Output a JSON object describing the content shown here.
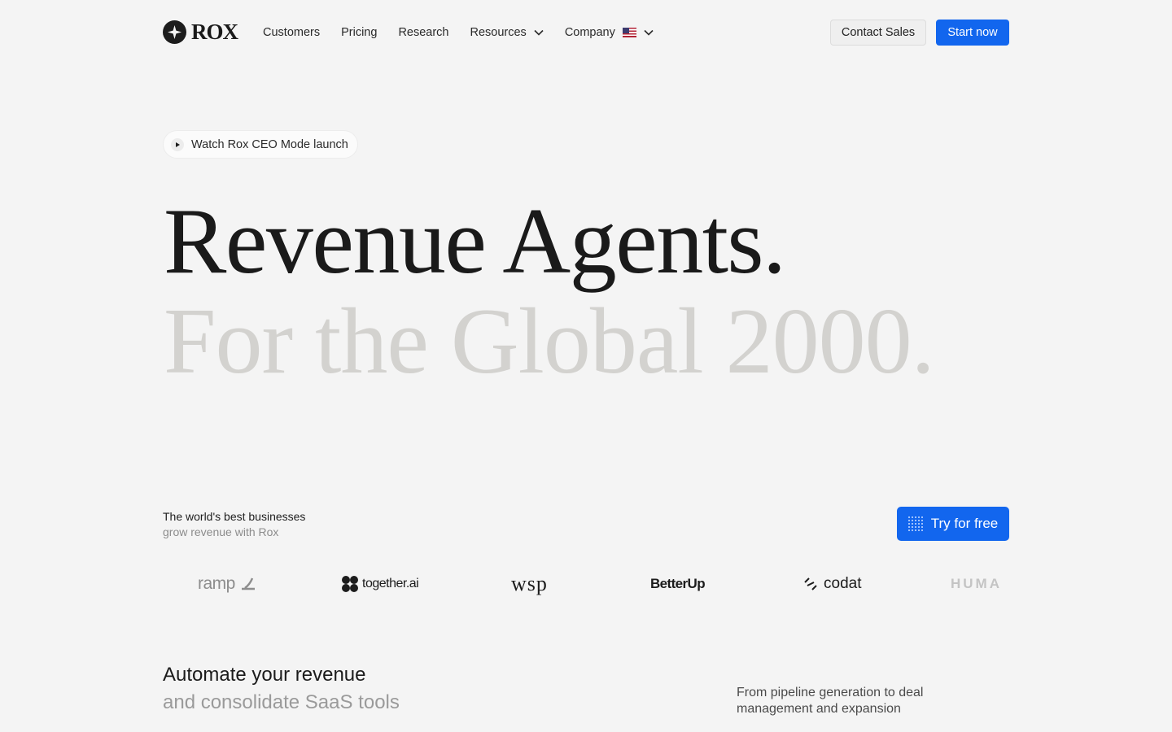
{
  "header": {
    "logo_text": "ROX",
    "nav": [
      {
        "label": "Customers"
      },
      {
        "label": "Pricing"
      },
      {
        "label": "Research"
      },
      {
        "label": "Resources"
      },
      {
        "label": "Company"
      }
    ],
    "contact_label": "Contact Sales",
    "start_label": "Start now"
  },
  "hero": {
    "pill_label": "Watch Rox CEO Mode launch",
    "headline_line1": "Revenue Agents.",
    "headline_line2": "For the Global 2000."
  },
  "trust": {
    "line1": "The world's best businesses",
    "line2": "grow revenue with Rox",
    "try_label": "Try for free",
    "logos": [
      "ramp",
      "together.ai",
      "wsp",
      "BetterUp",
      "codat",
      "HUMA"
    ]
  },
  "automate": {
    "line1": "Automate your revenue",
    "line2": "and consolidate SaaS tools",
    "side_text": "From pipeline generation to deal management and expansion"
  },
  "colors": {
    "accent": "#1266ee",
    "background": "#f4f4f4",
    "headline": "#1a1a1a",
    "headline_muted": "#d3d2cf"
  },
  "icons": [
    "rox-logo-icon",
    "chevron-down-icon",
    "us-flag-icon",
    "play-icon",
    "dots-grid-icon",
    "ramp-wing-icon",
    "together-logo-icon",
    "codat-arrows-icon"
  ]
}
